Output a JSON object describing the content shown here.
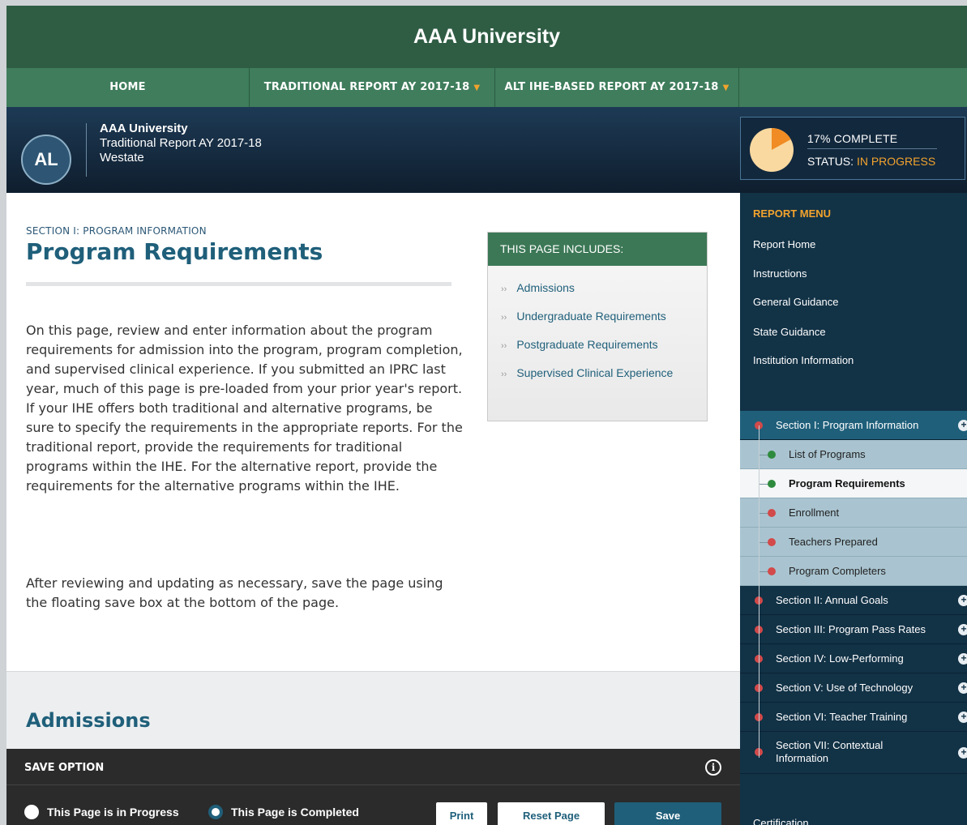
{
  "header": {
    "title": "AAA University",
    "nav": [
      {
        "label": "HOME",
        "has_caret": false
      },
      {
        "label": "TRADITIONAL REPORT AY 2017-18",
        "has_caret": true
      },
      {
        "label": "ALT IHE-BASED REPORT AY 2017-18",
        "has_caret": true
      }
    ],
    "caret_glyph": "▼"
  },
  "identity": {
    "avatar_initials": "AL",
    "name": "AAA University",
    "report": "Traditional Report AY 2017-18",
    "state": "Westate"
  },
  "progress": {
    "percent": 17,
    "label": "17% COMPLETE",
    "status_prefix": "STATUS:",
    "status_value": "IN PROGRESS"
  },
  "main": {
    "section_label": "SECTION I: PROGRAM INFORMATION",
    "title": "Program Requirements",
    "paragraph1": "On this page, review and enter information about the program requirements for admission into the program, program completion, and supervised clinical experience. If you submitted an IPRC last year, much of this page is pre-loaded from your prior year's report. If your IHE offers both traditional and alternative programs, be sure to specify the requirements in the appropriate reports. For the traditional report, provide the requirements for traditional programs within the IHE. For the alternative report, provide the requirements for the alternative programs within the IHE.",
    "paragraph2": "After reviewing and updating as necessary, save the page using the floating save box at the bottom of the page.",
    "includes": {
      "heading": "THIS PAGE INCLUDES:",
      "chevron": "››",
      "items": [
        "Admissions",
        "Undergraduate Requirements",
        "Postgraduate Requirements",
        "Supervised Clinical Experience"
      ]
    },
    "admissions_title": "Admissions"
  },
  "save_bar": {
    "title": "SAVE OPTION",
    "info_glyph": "i",
    "radio_in_progress": "This Page is in Progress",
    "radio_completed": "This Page is Completed",
    "selected": "completed",
    "print_label": "Print",
    "reset_label": "Reset Page",
    "save_label": "Save"
  },
  "sidebar": {
    "heading": "REPORT MENU",
    "links": [
      "Report Home",
      "Instructions",
      "General Guidance",
      "State Guidance",
      "Institution Information"
    ],
    "sections": [
      {
        "label": "Section I: Program Information",
        "active": true
      },
      {
        "label": "Section II: Annual Goals",
        "active": false
      },
      {
        "label": "Section III: Program Pass Rates",
        "active": false
      },
      {
        "label": "Section IV: Low-Performing",
        "active": false
      },
      {
        "label": "Section V: Use of Technology",
        "active": false
      },
      {
        "label": "Section VI: Teacher Training",
        "active": false
      },
      {
        "label": "Section VII: Contextual Information",
        "active": false
      }
    ],
    "subitems": [
      {
        "label": "List of Programs",
        "status_color": "#2e8b3e"
      },
      {
        "label": "Program Requirements",
        "status_color": "#2e8b3e",
        "current": true
      },
      {
        "label": "Enrollment",
        "status_color": "#d24a4a"
      },
      {
        "label": "Teachers Prepared",
        "status_color": "#d24a4a"
      },
      {
        "label": "Program Completers",
        "status_color": "#d24a4a"
      }
    ],
    "plus_glyph": "+",
    "certification": "Certification"
  },
  "colors": {
    "brand_green": "#2f5d44",
    "nav_green": "#3f7d5c",
    "accent_orange": "#f3a32d",
    "title_blue": "#1f5f7a",
    "sidebar_navy": "#123246"
  }
}
